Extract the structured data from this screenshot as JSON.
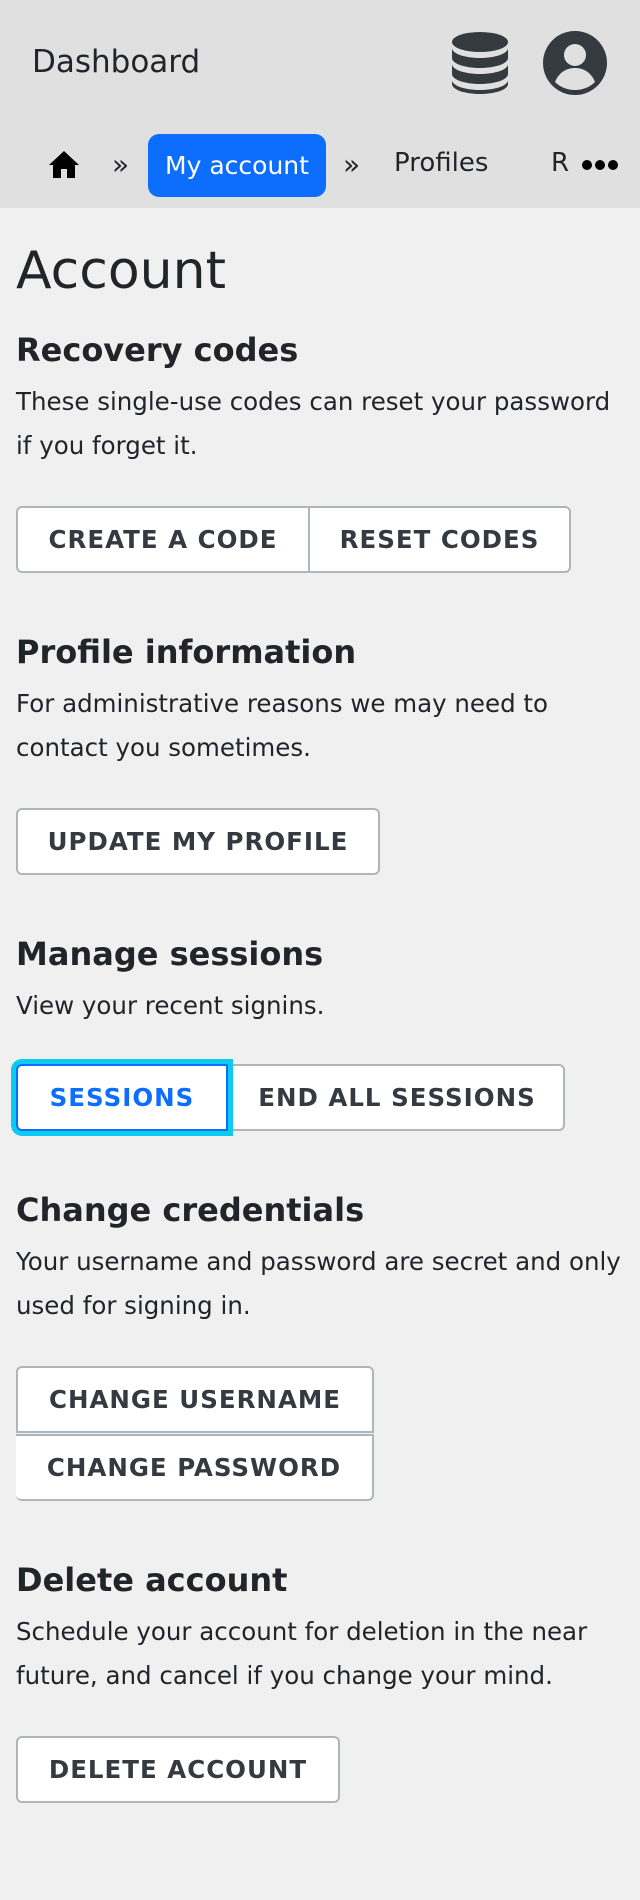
{
  "header": {
    "app_title": "Dashboard",
    "icons": [
      "database-icon",
      "user-circle-icon"
    ]
  },
  "breadcrumb": {
    "home_icon": "home-icon",
    "separator": "»",
    "items": [
      {
        "label": "My account",
        "active": true
      },
      {
        "label": "Profiles",
        "active": false
      },
      {
        "label": "R",
        "active": false
      }
    ],
    "overflow_icon": "more-horizontal-icon"
  },
  "main": {
    "title": "Account",
    "sections": {
      "recovery": {
        "heading": "Recovery codes",
        "description": "These single-use codes can reset your password if you forget it.",
        "buttons": [
          "CREATE A CODE",
          "RESET CODES"
        ]
      },
      "profile": {
        "heading": "Profile information",
        "description": "For administrative reasons we may need to contact you sometimes.",
        "buttons": [
          "UPDATE MY PROFILE"
        ]
      },
      "sessions": {
        "heading": "Manage sessions",
        "description": "View your recent signins.",
        "buttons": [
          "SESSIONS",
          "END ALL SESSIONS"
        ]
      },
      "credentials": {
        "heading": "Change credentials",
        "description": "Your username and password are secret and only used for signing in.",
        "buttons": [
          "CHANGE USERNAME",
          "CHANGE PASSWORD"
        ]
      },
      "delete": {
        "heading": "Delete account",
        "description": "Schedule your account for deletion in the near future, and cancel if you change your mind.",
        "buttons": [
          "DELETE ACCOUNT"
        ]
      }
    }
  },
  "colors": {
    "header_bg": "#e0e0e0",
    "page_bg": "#f0f0f0",
    "accent": "#0d6efd",
    "focus_ring": "#0dcaf0",
    "text": "#212529"
  }
}
